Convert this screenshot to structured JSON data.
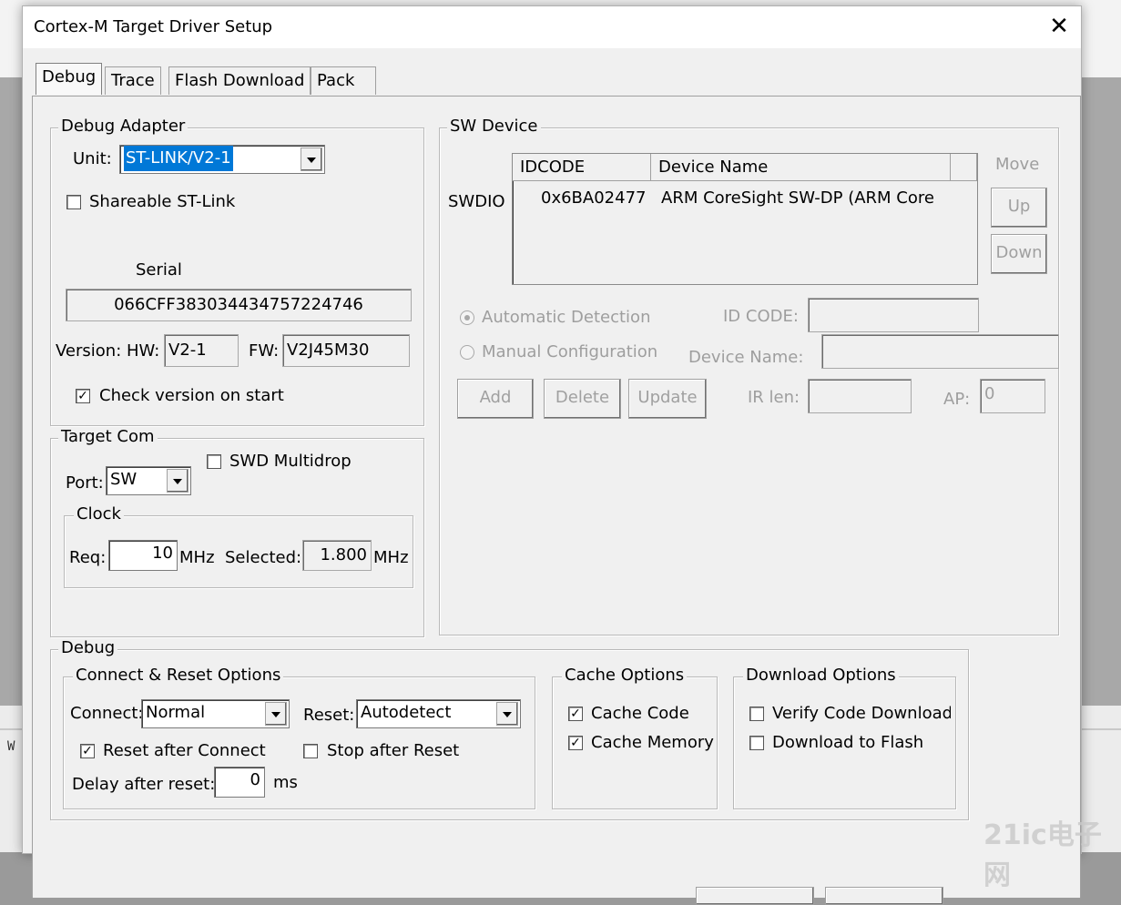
{
  "dialog": {
    "title": "Cortex-M Target Driver Setup",
    "close_glyph": "✕"
  },
  "tabs": [
    "Debug",
    "Trace",
    "Flash Download",
    "Pack"
  ],
  "debug_adapter": {
    "title": "Debug Adapter",
    "unit_label": "Unit:",
    "unit_value": "ST-LINK/V2-1",
    "shareable_label": "Shareable ST-Link",
    "shareable_checked": false,
    "serial_label": "Serial",
    "serial_value": "066CFF383034434757224746",
    "version_label": "Version: HW:",
    "hw_value": "V2-1",
    "fw_label": "FW:",
    "fw_value": "V2J45M30",
    "check_version_label": "Check version on start",
    "check_version_checked": true
  },
  "target_com": {
    "title": "Target Com",
    "swd_multidrop_label": "SWD Multidrop",
    "port_label": "Port:",
    "port_value": "SW",
    "clock_title": "Clock",
    "req_label": "Req:",
    "req_value": "10",
    "mhz1": "MHz",
    "selected_label": "Selected:",
    "selected_value": "1.800",
    "mhz2": "MHz"
  },
  "sw_device": {
    "title": "SW Device",
    "swdio_label": "SWDIO",
    "col_idcode": "IDCODE",
    "col_device_name": "Device Name",
    "rows": [
      {
        "idcode": "0x6BA02477",
        "device_name": "ARM CoreSight SW-DP (ARM Core"
      }
    ],
    "move_label": "Move",
    "up_label": "Up",
    "down_label": "Down",
    "auto_detect_label": "Automatic Detection",
    "manual_config_label": "Manual Configuration",
    "id_code_label": "ID CODE:",
    "device_name_label": "Device Name:",
    "add_label": "Add",
    "delete_label": "Delete",
    "update_label": "Update",
    "ir_len_label": "IR len:",
    "ap_label": "AP:",
    "ap_value": "0"
  },
  "debug": {
    "title": "Debug",
    "connect_reset_title": "Connect & Reset Options",
    "connect_label": "Connect:",
    "connect_value": "Normal",
    "reset_label": "Reset:",
    "reset_value": "Autodetect",
    "reset_after_connect_label": "Reset after Connect",
    "stop_after_reset_label": "Stop after Reset",
    "delay_label": "Delay after reset:",
    "delay_value": "0",
    "ms_label": "ms",
    "cache_title": "Cache Options",
    "cache_code_label": "Cache Code",
    "cache_memory_label": "Cache Memory",
    "download_title": "Download Options",
    "verify_code_label": "Verify Code Download",
    "download_flash_label": "Download to Flash"
  },
  "background": {
    "output_char": "W"
  },
  "watermark": "21ic电子网"
}
